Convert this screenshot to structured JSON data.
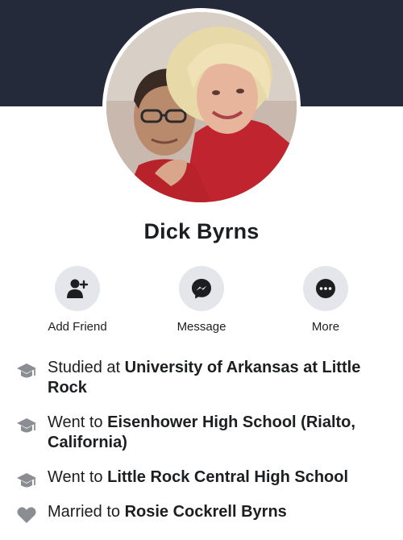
{
  "profile": {
    "name": "Dick Byrns"
  },
  "actions": [
    {
      "label": "Add Friend",
      "icon": "add-friend-icon"
    },
    {
      "label": "Message",
      "icon": "messenger-icon"
    },
    {
      "label": "More",
      "icon": "more-icon"
    }
  ],
  "details": [
    {
      "icon": "education-icon",
      "prefix": "Studied at ",
      "value": "University of Arkansas at Little Rock"
    },
    {
      "icon": "education-icon",
      "prefix": "Went to ",
      "value": "Eisenhower High School (Rialto, California)"
    },
    {
      "icon": "education-icon",
      "prefix": "Went to ",
      "value": "Little Rock Central High School"
    },
    {
      "icon": "heart-icon",
      "prefix": "Married to ",
      "value": "Rosie Cockrell Byrns"
    }
  ],
  "colors": {
    "cover": "#252a3a",
    "button_bg": "#e4e6eb",
    "icon_gray": "#8a8d91",
    "text": "#1c1e21"
  }
}
